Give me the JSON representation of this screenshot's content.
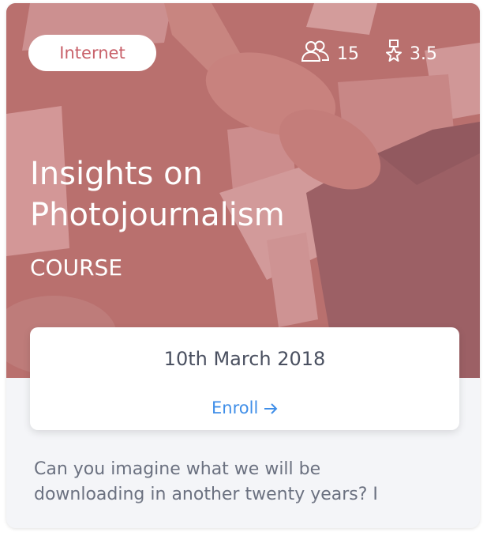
{
  "card": {
    "category": "Internet",
    "students": {
      "icon": "users-icon",
      "count": "15"
    },
    "rating": {
      "icon": "award-star-icon",
      "value": "3.5"
    },
    "title_line1": "Insights on",
    "title_line2": "Photojournalism",
    "type": "COURSE",
    "date": "10th March 2018",
    "enroll_label": "Enroll",
    "enroll_icon": "arrow-right-icon",
    "description_line1": "Can you imagine what we will be",
    "description_line2": "downloading in another twenty years? I"
  },
  "colors": {
    "accent": "#c8616a",
    "link": "#3f8ee8",
    "text_muted": "#6b7180"
  }
}
